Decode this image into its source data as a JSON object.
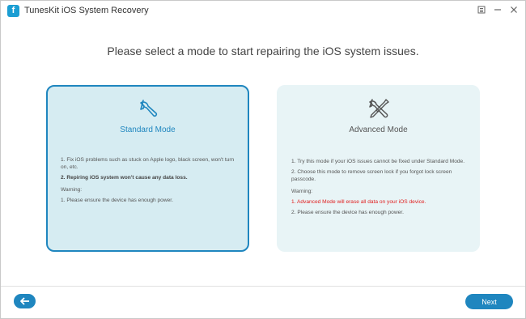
{
  "window": {
    "logo_glyph": "f",
    "title": "TunesKit iOS System Recovery",
    "controls": [
      "menu-icon",
      "minimize-icon",
      "close-icon"
    ]
  },
  "headline": "Please select a mode to start repairing the iOS system issues.",
  "modes": {
    "standard": {
      "icon": "wrench-icon",
      "title": "Standard Mode",
      "point1": "1. Fix iOS problems such as stuck on Apple logo, black screen, won't turn on, etc.",
      "point2": "2. Repiring iOS system won't cause any data loss.",
      "warning_label": "Warning:",
      "warning1": "1. Please ensure the device has enough power.",
      "selected": true
    },
    "advanced": {
      "icon": "wrench-screwdriver-icon",
      "title": "Advanced Mode",
      "point1": "1. Try this mode if your iOS issues cannot be fixed under Standard Mode.",
      "point2": "2. Choose this mode to remove screen lock if you forgot lock screen passcode.",
      "warning_label": "Warning:",
      "warning1": "1. Advanced Mode will erase all data on your iOS device.",
      "warning2": "2. Please ensure the device has enough power.",
      "selected": false
    }
  },
  "footer": {
    "back_icon": "arrow-left-icon",
    "next_label": "Next"
  },
  "colors": {
    "accent": "#1f86bf",
    "selected_card_bg": "#d6ecf2",
    "card_bg": "#e8f4f6",
    "warning_red": "#e02020"
  }
}
